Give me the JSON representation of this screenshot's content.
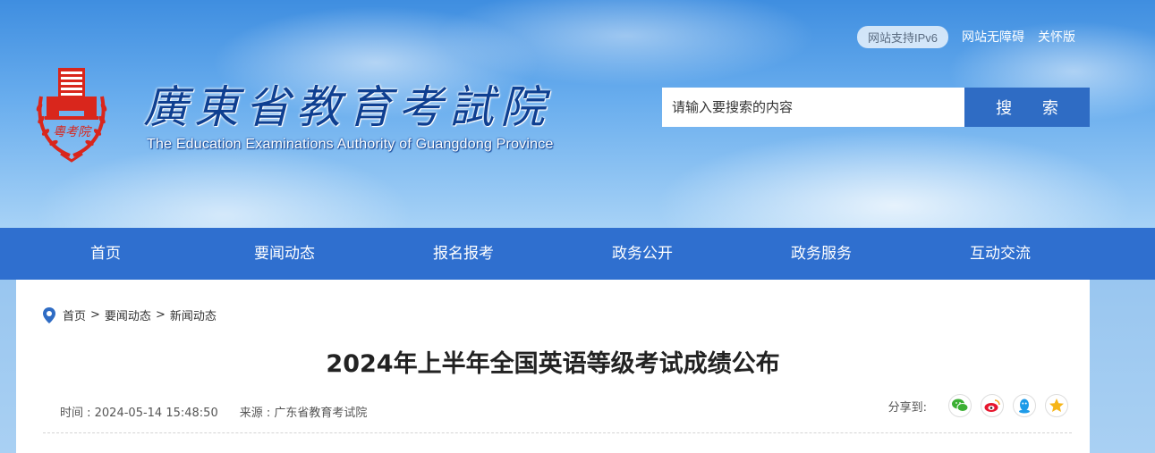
{
  "header": {
    "title_cn": "廣東省教育考試院",
    "title_en": "The Education Examinations Authority of Guangdong Province",
    "logo_text": "粵考院",
    "ipv6_badge": "网站支持IPv6",
    "accessibility_link": "网站无障碍",
    "care_mode_link": "关怀版"
  },
  "search": {
    "placeholder": "请输入要搜索的内容",
    "button_label": "搜 索"
  },
  "nav": {
    "items": [
      "首页",
      "要闻动态",
      "报名报考",
      "政务公开",
      "政务服务",
      "互动交流"
    ]
  },
  "breadcrumb": {
    "items": [
      "首页",
      "要闻动态",
      "新闻动态"
    ],
    "separator": ">"
  },
  "article": {
    "title": "2024年上半年全国英语等级考试成绩公布",
    "time": "时间 : 2024-05-14 15:48:50",
    "source": "来源 : 广东省教育考试院"
  },
  "share": {
    "label": "分享到:",
    "icons": [
      "wechat-icon",
      "weibo-icon",
      "qq-icon",
      "qzone-icon"
    ]
  },
  "colors": {
    "nav_bg": "#2f6fcf",
    "search_button": "#2f6cc4",
    "logo_red": "#d9261c",
    "title_blue": "#0e3f91"
  }
}
